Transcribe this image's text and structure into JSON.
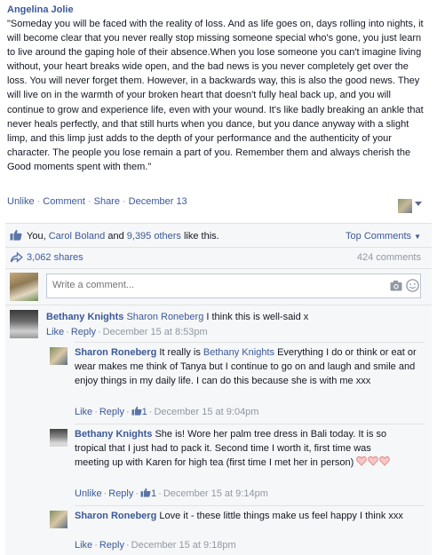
{
  "post": {
    "author": "Angelina Jolie",
    "text": "\"Someday you will be faced with the reality of loss. And as life goes on, days rolling into nights, it will become clear that you never really stop missing someone special who's gone, you just learn to live around the gaping hole of their absence.When you lose someone you can't imagine living without, your heart breaks wide open, and the bad news is you never completely get over the loss. You will never forget them. However, in a backwards way, this is also the good news. They will live on in the warmth of your broken heart that doesn't fully heal back up, and you will continue to grow and experience life, even with your wound. It's like badly breaking an ankle that never heals perfectly, and that still hurts when you dance, but you dance anyway with a slight limp, and this limp just adds to the depth of your performance and the authenticity of your character. The people you lose remain a part of you. Remember them and always cherish the Good moments spent with them.\"",
    "actions": {
      "unlike": "Unlike",
      "comment": "Comment",
      "share": "Share",
      "date": "December 13"
    }
  },
  "ufi": {
    "likes_you": "You,",
    "likes_name": "Carol Boland",
    "likes_and": "and",
    "likes_others": "9,395 others",
    "likes_tail": "like this.",
    "top_comments": "Top Comments",
    "shares": "3,062 shares",
    "comments_count": "424 comments",
    "compose_placeholder": "Write a comment..."
  },
  "comments": [
    {
      "author": "Bethany Knights",
      "mention": "Sharon Roneberg",
      "text": "I think this is well-said x",
      "like": "Like",
      "reply": "Reply",
      "date": "December 15 at 8:53pm"
    }
  ],
  "replies": [
    {
      "author": "Sharon Roneberg",
      "text_pre": "It really is",
      "mention": "Bethany Knights",
      "text_post": "Everything I do or think or eat or wear makes me think of Tanya but I continue to go on and laugh and smile and enjoy things in my daily life. I can do this because she is with me xxx",
      "like": "Like",
      "reply": "Reply",
      "likes": "1",
      "date": "December 15 at 9:04pm"
    },
    {
      "author": "Bethany Knights",
      "text": "She is! Wore her palm tree dress in Bali today. It is so tropical that I just had to pack it. Second time I worth it, first time was meeting up with Karen for high tea (first time I met her in person)",
      "like": "Unlike",
      "reply": "Reply",
      "likes": "1",
      "date": "December 15 at 9:14pm"
    },
    {
      "author": "Sharon Roneberg",
      "text": "Love it - these little things make us feel happy I think xxx",
      "like": "Like",
      "reply": "Reply",
      "date": "December 15 at 9:18pm"
    }
  ]
}
